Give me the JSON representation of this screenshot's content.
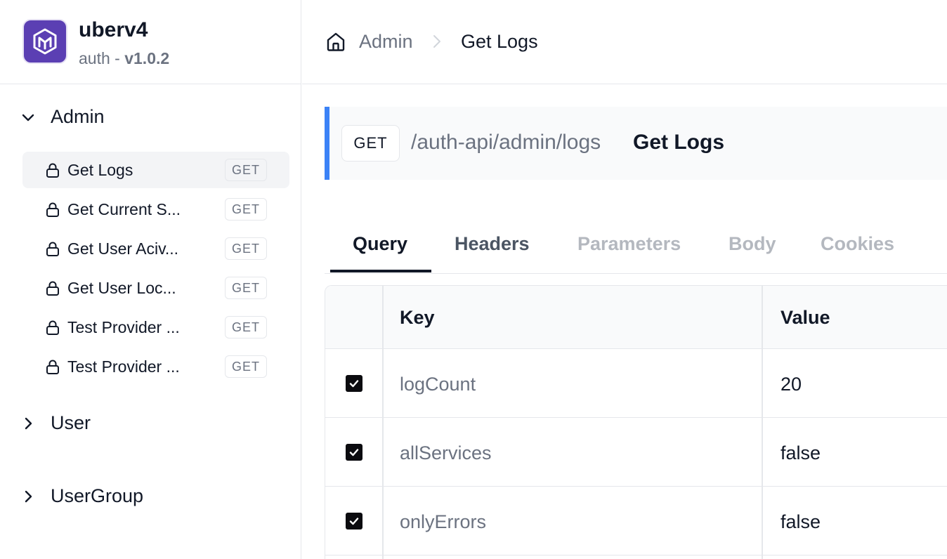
{
  "brand": {
    "name": "uberv4",
    "sub_prefix": "auth - ",
    "version": "v1.0.2",
    "logo_color": "#5b3fb3"
  },
  "sidebar": {
    "groups": [
      {
        "label": "Admin",
        "expanded": true,
        "items": [
          {
            "label": "Get Logs",
            "method": "GET",
            "active": true
          },
          {
            "label": "Get Current S...",
            "method": "GET"
          },
          {
            "label": "Get User Aciv...",
            "method": "GET"
          },
          {
            "label": "Get User Loc...",
            "method": "GET"
          },
          {
            "label": "Test Provider ...",
            "method": "GET"
          },
          {
            "label": "Test Provider ...",
            "method": "GET"
          }
        ]
      },
      {
        "label": "User",
        "expanded": false
      },
      {
        "label": "UserGroup",
        "expanded": false
      }
    ]
  },
  "breadcrumb": {
    "parent": "Admin",
    "current": "Get Logs"
  },
  "endpoint": {
    "method": "GET",
    "path": "/auth-api/admin/logs",
    "title": "Get Logs",
    "accent": "#3b82f6"
  },
  "tabs": [
    {
      "label": "Query",
      "state": "active"
    },
    {
      "label": "Headers",
      "state": "enabled"
    },
    {
      "label": "Parameters",
      "state": "disabled"
    },
    {
      "label": "Body",
      "state": "disabled"
    },
    {
      "label": "Cookies",
      "state": "disabled"
    }
  ],
  "table": {
    "headers": {
      "key": "Key",
      "value": "Value"
    },
    "rows": [
      {
        "checked": true,
        "key": "logCount",
        "value": "20"
      },
      {
        "checked": true,
        "key": "allServices",
        "value": "false"
      },
      {
        "checked": true,
        "key": "onlyErrors",
        "value": "false"
      }
    ]
  }
}
